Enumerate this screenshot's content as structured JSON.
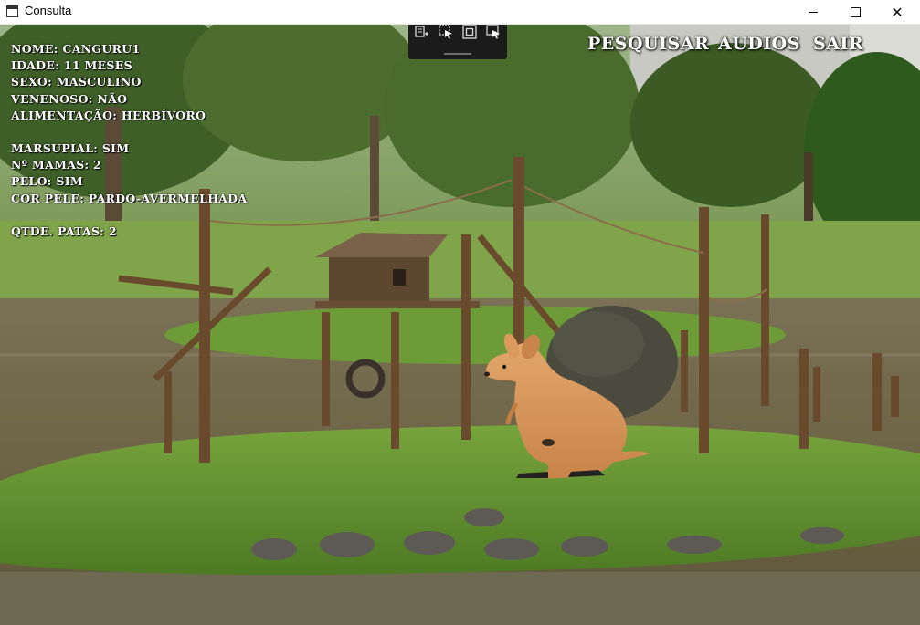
{
  "window": {
    "title": "Consulta",
    "controls": {
      "minimize": "minimize-icon",
      "maximize": "maximize-icon",
      "close": "close-icon"
    }
  },
  "menu": {
    "pesquisar": "PESQUISAR",
    "audios": "AUDIOS",
    "sair": "SAIR"
  },
  "animal_info": {
    "nome": "NOME: CANGURU1",
    "idade": "IDADE: 11 MESES",
    "sexo": "SEXO: MASCULINO",
    "venenoso": "VENENOSO: NÃO",
    "alimentacao": "ALIMENTAÇÃO: HERBÍVORO",
    "marsupial": "MARSUPIAL: SIM",
    "mamas": "Nº MAMAS: 2",
    "pelo": "PELO: SIM",
    "cor_pele": "COR PELE: PARDO-AVERMELHADA",
    "patas": "QTDE. PATAS: 2"
  },
  "debug_toolbar": {
    "icons": [
      "live-visual-tree-icon",
      "select-element-icon",
      "display-layout-adorners-icon",
      "track-focused-element-icon"
    ]
  },
  "colors": {
    "text": "#ffffff",
    "grass": "#5f8f2f",
    "water": "#6b6242",
    "wood": "#6a4a2c",
    "kangaroo": "#d99a5c"
  }
}
